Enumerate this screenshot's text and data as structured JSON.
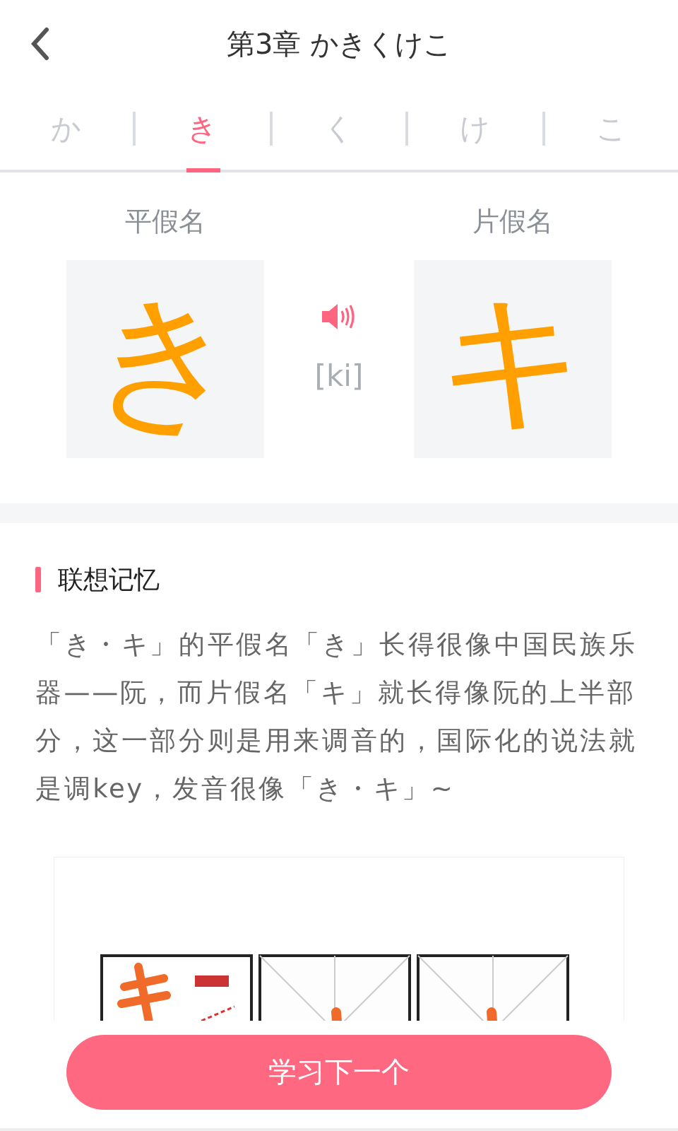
{
  "header": {
    "title": "第3章 かきくけこ"
  },
  "tabs": [
    {
      "label": "か",
      "selected": false
    },
    {
      "label": "き",
      "selected": true
    },
    {
      "label": "く",
      "selected": false
    },
    {
      "label": "け",
      "selected": false
    },
    {
      "label": "こ",
      "selected": false
    }
  ],
  "kana": {
    "hiragana_label": "平假名",
    "hiragana": "き",
    "katakana_label": "片假名",
    "katakana": "キ",
    "romaji": "[ki]"
  },
  "memory": {
    "heading": "联想记忆",
    "text": "「き・キ」的平假名「き」长得很像中国民族乐器——阮，而片假名「キ」就长得像阮的上半部分，这一部分则是用来调音的，国际化的说法就是调key，发音很像「き・キ」~"
  },
  "next_button": "学习下一个"
}
